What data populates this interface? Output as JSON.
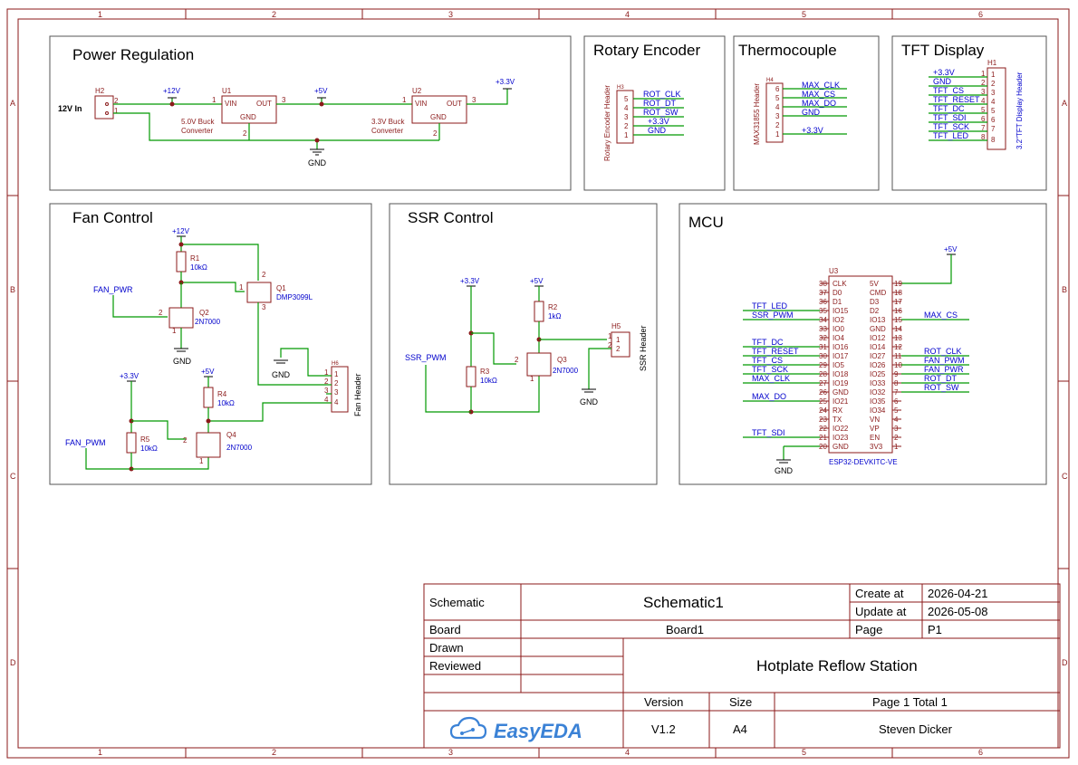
{
  "frame": {
    "cols": [
      "1",
      "2",
      "3",
      "4",
      "5",
      "6"
    ],
    "rows": [
      "A",
      "B",
      "C",
      "D"
    ]
  },
  "sections": {
    "power": "Power Regulation",
    "rotary": "Rotary Encoder",
    "thermo": "Thermocouple",
    "tft": "TFT Display",
    "fan": "Fan Control",
    "ssr": "SSR Control",
    "mcu": "MCU"
  },
  "power": {
    "h2": "H2",
    "in12": "12V In",
    "p12": "+12V",
    "p5": "+5V",
    "p33": "+3.3V",
    "u1": "U1",
    "u2": "U2",
    "vin": "VIN",
    "out": "OUT",
    "gnd": "GND",
    "u1_desc_1": "5.0V Buck",
    "u1_desc_2": "Converter",
    "u2_desc_1": "3.3V Buck",
    "u2_desc_2": "Converter",
    "gnd_label": "GND"
  },
  "rotary": {
    "ref": "H3",
    "vlabel": "Rotary Encoder Header",
    "pins": [
      "5",
      "4",
      "3",
      "2",
      "1"
    ],
    "nets": [
      "ROT_CLK",
      "ROT_DT",
      "ROT_SW",
      "+3.3V",
      "GND"
    ]
  },
  "thermo": {
    "ref": "H4",
    "vlabel": "MAX31855 Header",
    "pins": [
      "6",
      "5",
      "4",
      "3",
      "2",
      "1"
    ],
    "nets": [
      "MAX_CLK",
      "MAX_CS",
      "MAX_DO",
      "GND",
      "",
      "+3.3V"
    ]
  },
  "tft": {
    "ref": "H1",
    "vlabel": "3.2\"TFT Display Header",
    "pins": [
      "1",
      "2",
      "3",
      "4",
      "5",
      "6",
      "7",
      "8"
    ],
    "nets": [
      "+3.3V",
      "GND",
      "TFT_CS",
      "TFT_RESET",
      "TFT_DC",
      "TFT_SDI",
      "TFT_SCK",
      "TFT_LED"
    ]
  },
  "fan": {
    "p12": "+12V",
    "r1": "R1",
    "r1v": "10kΩ",
    "q1": "Q1",
    "q1v": "DMP3099L",
    "fan_pwr": "FAN_PWR",
    "q2": "Q2",
    "q2v": "2N7000",
    "gnd": "GND",
    "p33": "+3.3V",
    "p5": "+5V",
    "r4": "R4",
    "r4v": "10kΩ",
    "fan_pwm": "FAN_PWM",
    "r5": "R5",
    "r5v": "10kΩ",
    "q4": "Q4",
    "q4v": "2N7000",
    "hdr_ref": "H6",
    "hdr": "Fan Header",
    "pins": [
      "1",
      "2",
      "3",
      "4"
    ]
  },
  "ssr": {
    "p33": "+3.3V",
    "p5": "+5V",
    "r2": "R2",
    "r2v": "1kΩ",
    "ssr_pwm": "SSR_PWM",
    "r3": "R3",
    "r3v": "10kΩ",
    "q3": "Q3",
    "q3v": "2N7000",
    "h5": "H5",
    "hdr": "SSR Header",
    "gnd": "GND"
  },
  "mcu": {
    "p5": "+5V",
    "u3": "U3",
    "name": "ESP32-DEVKITC-VE",
    "gnd": "GND",
    "left_nums": [
      "38",
      "37",
      "36",
      "35",
      "34",
      "33",
      "32",
      "31",
      "30",
      "29",
      "28",
      "27",
      "26",
      "25",
      "24",
      "23",
      "22",
      "21",
      "20"
    ],
    "left_pins": [
      "CLK",
      "D0",
      "D1",
      "IO15",
      "IO2",
      "IO0",
      "IO4",
      "IO16",
      "IO17",
      "IO5",
      "IO18",
      "IO19",
      "GND",
      "IO21",
      "RX",
      "TX",
      "IO22",
      "IO23",
      "GND"
    ],
    "left_nets": [
      "",
      "",
      "",
      "TFT_LED",
      "SSR_PWM",
      "",
      "",
      "TFT_DC",
      "TFT_RESET",
      "TFT_CS",
      "TFT_SCK",
      "MAX_CLK",
      "",
      "MAX_DO",
      "",
      "",
      "",
      "TFT_SDI",
      ""
    ],
    "right_nums": [
      "19",
      "18",
      "17",
      "16",
      "15",
      "14",
      "13",
      "12",
      "11",
      "10",
      "9",
      "8",
      "7",
      "6",
      "5",
      "4",
      "3",
      "2",
      "1"
    ],
    "right_pins": [
      "5V",
      "CMD",
      "D3",
      "D2",
      "IO13",
      "GND",
      "IO12",
      "IO14",
      "IO27",
      "IO26",
      "IO25",
      "IO33",
      "IO32",
      "IO35",
      "IO34",
      "VN",
      "VP",
      "EN",
      "3V3"
    ],
    "right_nets": [
      "",
      "",
      "",
      "",
      "MAX_CS",
      "",
      "",
      "",
      "ROT_CLK",
      "FAN_PWM",
      "FAN_PWR",
      "ROT_DT",
      "ROT_SW",
      "",
      "",
      "",
      "",
      "",
      ""
    ]
  },
  "titleblock": {
    "schematic_k": "Schematic",
    "schematic_v": "Schematic1",
    "create_k": "Create at",
    "create_v": "2026-04-21",
    "update_k": "Update at",
    "update_v": "2026-05-08",
    "board_k": "Board",
    "board_v": "Board1",
    "page_k": "Page",
    "page_v": "P1",
    "drawn_k": "Drawn",
    "reviewed_k": "Reviewed",
    "title": "Hotplate Reflow Station",
    "version_k": "Version",
    "size_k": "Size",
    "page_total": "Page  1  Total  1",
    "logo": "EasyEDA",
    "version_v": "V1.2",
    "size_v": "A4",
    "author": "Steven Dicker",
    "brand_color": "#3b82d6"
  }
}
